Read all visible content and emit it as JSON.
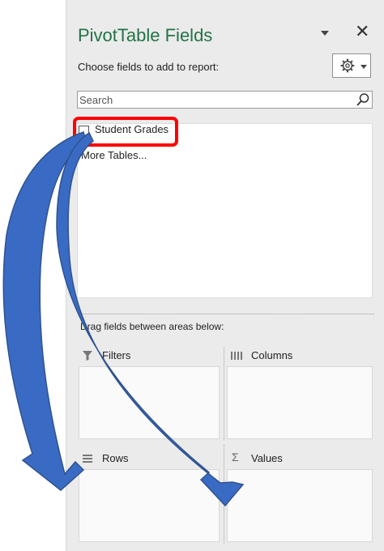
{
  "pane": {
    "title": "PivotTable Fields",
    "choose_label": "Choose fields to add to report:",
    "search": {
      "placeholder": "Search",
      "value": ""
    }
  },
  "fields": [
    {
      "label": "Student Grades",
      "checked": false
    }
  ],
  "more_tables": "More Tables...",
  "areas": {
    "drag_label": "Drag fields between areas below:",
    "filters": "Filters",
    "columns": "Columns",
    "rows": "Rows",
    "values": "Values"
  },
  "icons": {
    "pane_dropdown": "chevron-down-icon",
    "close": "close-icon",
    "settings": "gear-icon",
    "search": "search-icon",
    "filters": "filter-icon",
    "columns": "columns-icon",
    "rows": "rows-icon",
    "values": "sigma-icon"
  },
  "colors": {
    "title": "#217346",
    "highlight": "#ff0000",
    "arrow_fill": "#3a6bc4",
    "arrow_stroke": "#2f528f"
  }
}
